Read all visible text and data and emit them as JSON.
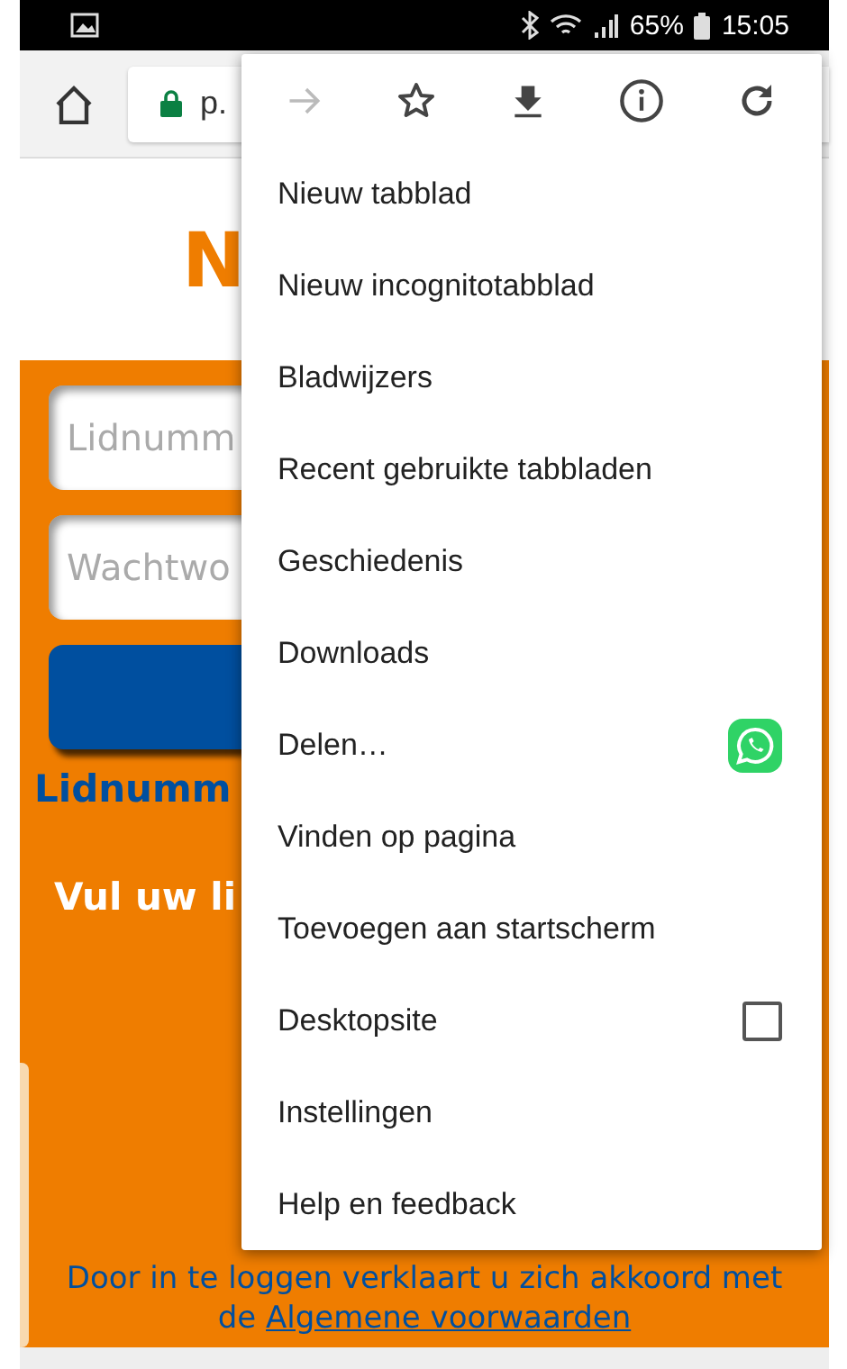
{
  "status_bar": {
    "battery": "65%",
    "time": "15:05"
  },
  "toolbar": {
    "url": "p."
  },
  "page": {
    "title": "N",
    "member_field": {
      "placeholder": "Lidnumm"
    },
    "password_field": {
      "placeholder": "Wachtwo"
    },
    "member_link": "Lidnumm",
    "instruction": "Vul uw li",
    "terms": "Door in te loggen verklaart u zich akkoord met",
    "terms_prefix": "de",
    "terms_link": "Algemene voorwaarden"
  },
  "menu": {
    "actions": [
      {
        "kind": "forward",
        "disabled": true
      },
      {
        "kind": "bookmark",
        "disabled": false
      },
      {
        "kind": "download",
        "disabled": false
      },
      {
        "kind": "info",
        "disabled": false
      },
      {
        "kind": "refresh",
        "disabled": false
      }
    ],
    "items": [
      {
        "kind": "plain",
        "label": "Nieuw tabblad"
      },
      {
        "kind": "plain",
        "label": "Nieuw incognitotabblad"
      },
      {
        "kind": "plain",
        "label": "Bladwijzers"
      },
      {
        "kind": "plain",
        "label": "Recent gebruikte tabbladen"
      },
      {
        "kind": "plain",
        "label": "Geschiedenis"
      },
      {
        "kind": "plain",
        "label": "Downloads"
      },
      {
        "kind": "share",
        "label": "Delen…"
      },
      {
        "kind": "plain",
        "label": "Vinden op pagina"
      },
      {
        "kind": "plain",
        "label": "Toevoegen aan startscherm"
      },
      {
        "kind": "checkbox",
        "label": "Desktopsite",
        "checked": false
      },
      {
        "kind": "plain",
        "label": "Instellingen"
      },
      {
        "kind": "plain",
        "label": "Help en feedback"
      }
    ]
  }
}
